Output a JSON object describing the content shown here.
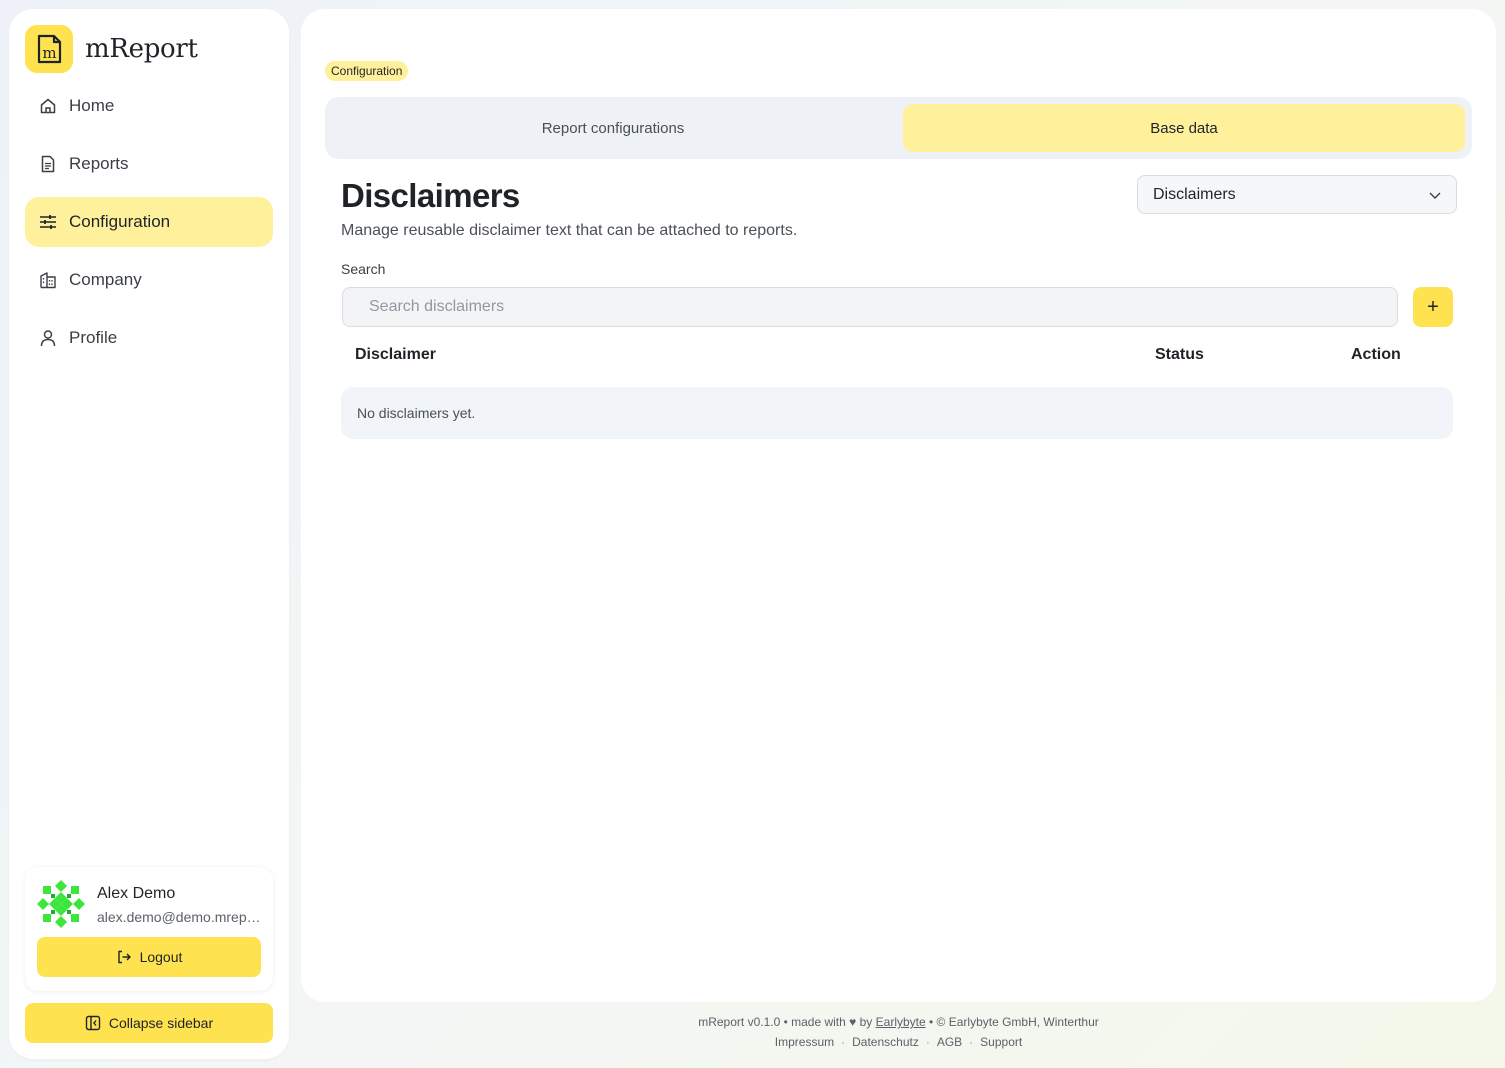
{
  "app": {
    "name": "mReport",
    "logo_letter": "m",
    "accent_color": "#ffe24f",
    "active_color": "#fff09c"
  },
  "sidebar": {
    "items": [
      {
        "label": "Home",
        "icon": "home-icon",
        "active": false
      },
      {
        "label": "Reports",
        "icon": "report-icon",
        "active": false
      },
      {
        "label": "Configuration",
        "icon": "sliders-icon",
        "active": true
      },
      {
        "label": "Company",
        "icon": "building-icon",
        "active": false
      },
      {
        "label": "Profile",
        "icon": "user-icon",
        "active": false
      }
    ],
    "user": {
      "name": "Alex Demo",
      "email": "alex.demo@demo.mreport.ch"
    },
    "logout_label": "Logout",
    "collapse_label": "Collapse sidebar"
  },
  "main": {
    "breadcrumb": "Configuration",
    "tabs": [
      {
        "label": "Report configurations",
        "active": false
      },
      {
        "label": "Base data",
        "active": true
      }
    ],
    "title": "Disclaimers",
    "subtitle": "Manage reusable disclaimer text that can be attached to reports.",
    "select_value": "Disclaimers",
    "search_label": "Search",
    "search_placeholder": "Search disclaimers",
    "add_label": "+",
    "table": {
      "headers": [
        "Disclaimer",
        "Status",
        "Action"
      ],
      "empty_text": "No disclaimers yet."
    }
  },
  "footer": {
    "version_text": "mReport v0.1.0 • made with ♥ by",
    "maker_link": "Earlybyte",
    "copyright_text": "• © Earlybyte GmbH, Winterthur",
    "links": [
      "Impressum",
      "Datenschutz",
      "AGB",
      "Support"
    ]
  }
}
